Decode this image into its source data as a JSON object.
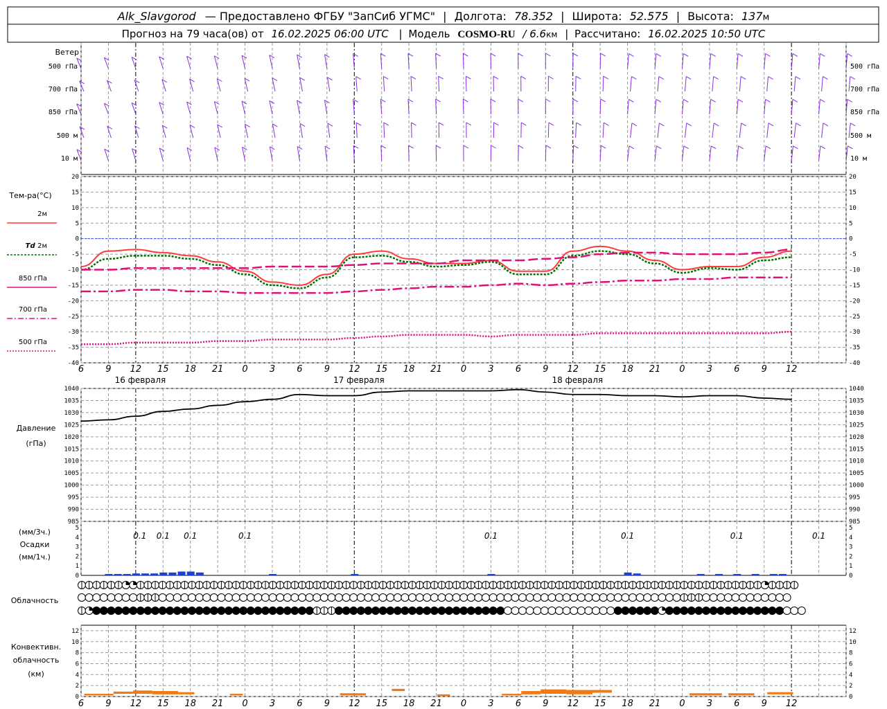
{
  "header": {
    "station": "Alk_Slavgorod",
    "provider": "— Предоставлено ФГБУ \"ЗапСиб УГМС\"",
    "lon_label": "Долгота:",
    "lon_value": "78.352",
    "lat_label": "Широта:",
    "lat_value": "52.575",
    "alt_label": "Высота:",
    "alt_value": "137",
    "alt_unit": "м",
    "forecast_prefix": "Прогноз на 79 часа(ов) от",
    "forecast_time": "16.02.2025 06:00 UTC",
    "model_label": "Модель",
    "model_name": "COSMO-RU",
    "model_res": "/ 6.6",
    "model_res_unit": "км",
    "calc_label": "Рассчитано:",
    "calc_time": "16.02.2025 10:50 UTC"
  },
  "colors": {
    "wind": "#8a2be2",
    "t2m": "#ff3a3a",
    "td2m": "#007000",
    "upper": "#e0107a",
    "pressure": "#000000",
    "precip": "#1f3fcf",
    "convective": "#f07a18",
    "zero_line": "#3050ff",
    "grid": "#999999"
  },
  "chart_data": {
    "type": "line",
    "x_ticks": [
      "6",
      "9",
      "12",
      "15",
      "18",
      "21",
      "0",
      "3",
      "6",
      "9",
      "12",
      "15",
      "18",
      "21",
      "0",
      "3",
      "6",
      "9",
      "12",
      "15",
      "18",
      "21",
      "0",
      "3",
      "6",
      "9",
      "12"
    ],
    "day_labels": [
      "16 февраля",
      "17 февраля",
      "18 февраля"
    ],
    "wind": {
      "title": "Ветер",
      "levels": [
        "500 гПа",
        "700 гПа",
        "850 гПа",
        "500 м",
        "10  м"
      ]
    },
    "temperature": {
      "title": "Тем-ра(°C)",
      "ylim": [
        -40,
        20
      ],
      "yticks": [
        "20",
        "15",
        "10",
        "5",
        "0",
        "-5",
        "-10",
        "-15",
        "-20",
        "-25",
        "-30",
        "-35",
        "-40"
      ],
      "legend": [
        {
          "name": "2м",
          "prefix": ""
        },
        {
          "name": "2м",
          "prefix": "Td"
        },
        {
          "name": "850 гПа",
          "prefix": ""
        },
        {
          "name": "700 гПа",
          "prefix": ""
        },
        {
          "name": "500 гПа",
          "prefix": ""
        }
      ],
      "series": [
        {
          "key": "t2m",
          "x": [
            0,
            3,
            6,
            9,
            12,
            15,
            18,
            21,
            24,
            27,
            30,
            33,
            36,
            39,
            42,
            45,
            48,
            51,
            54,
            57,
            60,
            63,
            66,
            69,
            72,
            75,
            78
          ],
          "values": [
            -9,
            -4,
            -3.5,
            -4.5,
            -5.5,
            -7.5,
            -10.5,
            -14,
            -15,
            -11.5,
            -5,
            -4,
            -6.5,
            -8,
            -8,
            -7,
            -10.5,
            -10.5,
            -4,
            -2.5,
            -4,
            -7,
            -10,
            -9,
            -9,
            -6,
            -4
          ]
        },
        {
          "key": "td2m",
          "x": [
            0,
            3,
            6,
            9,
            12,
            15,
            18,
            21,
            24,
            27,
            30,
            33,
            36,
            39,
            42,
            45,
            48,
            51,
            54,
            57,
            60,
            63,
            66,
            69,
            72,
            75,
            78
          ],
          "values": [
            -10,
            -6.5,
            -5.5,
            -5.5,
            -6.5,
            -8.5,
            -11.5,
            -15,
            -16,
            -12.5,
            -6,
            -5.5,
            -7.5,
            -9,
            -8.5,
            -7.5,
            -11.5,
            -11.5,
            -5.5,
            -4,
            -5,
            -8,
            -11,
            -9.5,
            -10,
            -7,
            -6
          ]
        },
        {
          "key": "t850",
          "x": [
            0,
            3,
            6,
            9,
            12,
            15,
            18,
            21,
            24,
            27,
            30,
            33,
            36,
            39,
            42,
            45,
            48,
            51,
            54,
            57,
            60,
            63,
            66,
            69,
            72,
            75,
            78
          ],
          "values": [
            -10,
            -10,
            -9.5,
            -9.5,
            -9.5,
            -9.5,
            -9.5,
            -9,
            -9,
            -9,
            -8.5,
            -8,
            -8,
            -8,
            -7,
            -7,
            -7,
            -6.5,
            -6,
            -5,
            -4.5,
            -4.5,
            -5,
            -5,
            -5,
            -4.5,
            -3.5
          ]
        },
        {
          "key": "t700",
          "x": [
            0,
            3,
            6,
            9,
            12,
            15,
            18,
            21,
            24,
            27,
            30,
            33,
            36,
            39,
            42,
            45,
            48,
            51,
            54,
            57,
            60,
            63,
            66,
            69,
            72,
            75,
            78
          ],
          "values": [
            -17,
            -17,
            -16.5,
            -16.5,
            -17,
            -17,
            -17.5,
            -17.5,
            -17.5,
            -17.5,
            -17,
            -16.5,
            -16,
            -15.5,
            -15.5,
            -15,
            -14.5,
            -15,
            -14.5,
            -14,
            -13.5,
            -13.5,
            -13,
            -13,
            -12.5,
            -12.5,
            -12.5
          ]
        },
        {
          "key": "t500",
          "x": [
            0,
            3,
            6,
            9,
            12,
            15,
            18,
            21,
            24,
            27,
            30,
            33,
            36,
            39,
            42,
            45,
            48,
            51,
            54,
            57,
            60,
            63,
            66,
            69,
            72,
            75,
            78
          ],
          "values": [
            -34,
            -34,
            -33.5,
            -33.5,
            -33.5,
            -33,
            -33,
            -32.5,
            -32.5,
            -32.5,
            -32,
            -31.5,
            -31,
            -31,
            -31,
            -31.5,
            -31,
            -31,
            -31,
            -30.5,
            -30.5,
            -30.5,
            -30.5,
            -30.5,
            -30.5,
            -30.5,
            -30
          ]
        }
      ]
    },
    "pressure": {
      "title": "Давление",
      "unit": "(гПа)",
      "ylim": [
        985,
        1040
      ],
      "yticks": [
        "1040",
        "1035",
        "1030",
        "1025",
        "1020",
        "1015",
        "1010",
        "1005",
        "1000",
        "995",
        "990",
        "985"
      ],
      "x": [
        0,
        3,
        6,
        9,
        12,
        15,
        18,
        21,
        24,
        27,
        30,
        33,
        36,
        39,
        42,
        45,
        48,
        51,
        54,
        57,
        60,
        63,
        66,
        69,
        72,
        75,
        78
      ],
      "values": [
        1026.5,
        1027,
        1028.5,
        1030.5,
        1031.5,
        1033,
        1034.5,
        1035.5,
        1037.5,
        1037,
        1037,
        1038.5,
        1039,
        1039,
        1039,
        1039,
        1039.5,
        1038.5,
        1037.5,
        1037.5,
        1037,
        1037,
        1036.5,
        1037,
        1037,
        1036,
        1035.5
      ]
    },
    "precipitation": {
      "title": "Осадки",
      "unit_3h": "(мм/3ч.)",
      "unit_1h": "(мм/1ч.)",
      "ylim": [
        0,
        5
      ],
      "yticks": [
        "5",
        "4",
        "3",
        "2",
        "1",
        "0"
      ],
      "labels": [
        {
          "hour": 6,
          "text": "0.1"
        },
        {
          "hour": 9,
          "text": "0.1"
        },
        {
          "hour": 12,
          "text": "0.1"
        },
        {
          "hour": 18,
          "text": "0.1"
        },
        {
          "hour": 45,
          "text": "0.1"
        },
        {
          "hour": 60,
          "text": "0.1"
        },
        {
          "hour": 72,
          "text": "0.1"
        },
        {
          "hour": 81,
          "text": "0.1"
        }
      ],
      "x": [
        3,
        4,
        5,
        6,
        7,
        8,
        9,
        10,
        11,
        12,
        13,
        14,
        15,
        16,
        17,
        18,
        19,
        20,
        21,
        22,
        23,
        24,
        25,
        26,
        27,
        28,
        29,
        30,
        31,
        32,
        33,
        34,
        35,
        36,
        37,
        38,
        39,
        40,
        41,
        42,
        43,
        44,
        45,
        46,
        47,
        48,
        49,
        50,
        51,
        52,
        53,
        54,
        55,
        56,
        57,
        58,
        59,
        60,
        61,
        62,
        63,
        64,
        65,
        66,
        67,
        68,
        69,
        70,
        71,
        72,
        73,
        74,
        75,
        76,
        77,
        78
      ],
      "values": [
        0.05,
        0.05,
        0.05,
        0.1,
        0.1,
        0.1,
        0.15,
        0.15,
        0.2,
        0.2,
        0.15,
        0,
        0,
        0,
        0,
        0,
        0,
        0,
        0.05,
        0,
        0,
        0,
        0,
        0,
        0,
        0,
        0,
        0.05,
        0,
        0,
        0,
        0,
        0,
        0,
        0,
        0,
        0,
        0,
        0,
        0,
        0,
        0,
        0.05,
        0,
        0,
        0,
        0,
        0,
        0,
        0,
        0,
        0,
        0,
        0,
        0,
        0,
        0,
        0.15,
        0.1,
        0,
        0,
        0,
        0,
        0,
        0,
        0.05,
        0,
        0.05,
        0,
        0.05,
        0,
        0.05,
        0,
        0.05,
        0.05,
        0
      ]
    },
    "cloud": {
      "title": "Облачность",
      "rows": [
        "HHHHHHQQHHHHHHHHHHHHHHHHHHHHHHHHHHHHHHHHHHHHHHHHHHHHHHHHHHHHHHHHHHHHHHHHHHHHHHHHHHHHHHHHHHHHHQHHHH",
        "OOOOOOOOHHHOOOOOOOOOOOOOOOOOOOOOOOOOOOOOOOOOOOOOOOOOOOOOOOOOOOOOOOOOOOOOOOOOOOOOOOHHHOOOOOOOOOOOO",
        "HQFFFFFFFFFFFFFFFFFFFFFFFFFFFFFFHHHFFFFFFFFFFFFFFFFFFFFFFFOOOOOOOOOOOOOOOFFFFFFQFFFFFFFFFFFFFFFFOOO"
      ]
    },
    "convective": {
      "title_1": "Конвективн.",
      "title_2": "облачность",
      "unit": "(км)",
      "ylim": [
        0,
        13
      ],
      "yticks": [
        "12",
        "10",
        "8",
        "6",
        "4",
        "2",
        "0"
      ],
      "segments": [
        {
          "from": 0.5,
          "to": 5,
          "base": 0.2,
          "top": 0.5
        },
        {
          "from": 5,
          "to": 8,
          "base": 0.5,
          "top": 0.9
        },
        {
          "from": 8,
          "to": 11,
          "base": 0.5,
          "top": 1.1
        },
        {
          "from": 11,
          "to": 15,
          "base": 0.4,
          "top": 1.0
        },
        {
          "from": 15,
          "to": 17.5,
          "base": 0.4,
          "top": 0.8
        },
        {
          "from": 23,
          "to": 25,
          "base": 0.2,
          "top": 0.5
        },
        {
          "from": 40,
          "to": 44,
          "base": 0.2,
          "top": 0.6
        },
        {
          "from": 48,
          "to": 50,
          "base": 1.0,
          "top": 1.4
        },
        {
          "from": 55,
          "to": 57,
          "base": 0.1,
          "top": 0.4
        },
        {
          "from": 65,
          "to": 68,
          "base": 0.2,
          "top": 0.5
        },
        {
          "from": 68,
          "to": 71,
          "base": 0.4,
          "top": 1.0
        },
        {
          "from": 71,
          "to": 75,
          "base": 0.5,
          "top": 1.3
        },
        {
          "from": 75,
          "to": 79,
          "base": 0.4,
          "top": 1.2
        },
        {
          "from": 79,
          "to": 82,
          "base": 0.7,
          "top": 1.2
        },
        {
          "from": 94,
          "to": 99,
          "base": 0.2,
          "top": 0.6
        },
        {
          "from": 100,
          "to": 104,
          "base": 0.2,
          "top": 0.6
        },
        {
          "from": 106,
          "to": 110,
          "base": 0.4,
          "top": 0.8
        }
      ]
    }
  }
}
